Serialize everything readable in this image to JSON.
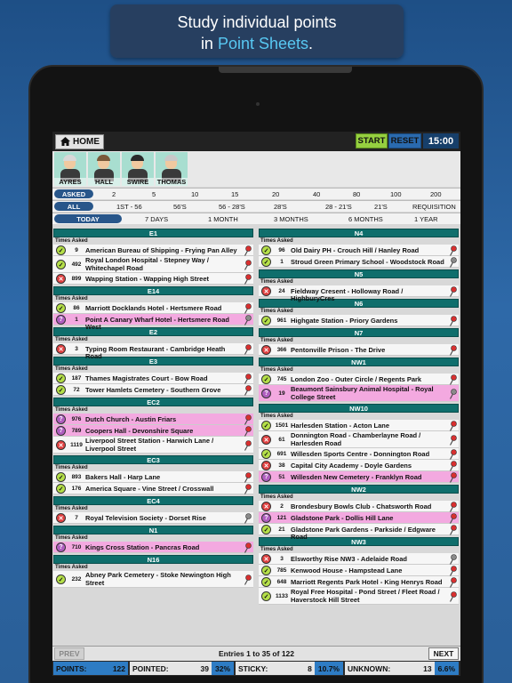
{
  "banner": {
    "line1": "Study individual points",
    "line2_prefix": "in ",
    "line2_highlight": "Point Sheets",
    "line2_suffix": "."
  },
  "toolbar": {
    "home_label": "HOME",
    "start_label": "START",
    "reset_label": "RESET",
    "timer": "15:00"
  },
  "avatars": [
    {
      "name": "AYRES",
      "hair": "#d8d8d8"
    },
    {
      "name": "HALL",
      "hair": "#7a5a3a"
    },
    {
      "name": "SWIRE",
      "hair": "#2a2a2a"
    },
    {
      "name": "THOMAS",
      "hair": "#c8c8c8"
    }
  ],
  "filters": {
    "asked": {
      "selected": "ASKED",
      "options": [
        "2",
        "5",
        "10",
        "15",
        "20",
        "40",
        "80",
        "100",
        "200"
      ]
    },
    "range": {
      "selected": "ALL",
      "options": [
        "1ST - 56",
        "56'S",
        "56 - 28'S",
        "28'S",
        "28 - 21'S",
        "21'S",
        "REQUISITION"
      ]
    },
    "period": {
      "selected": "TODAY",
      "options": [
        "7 DAYS",
        "1 MONTH",
        "3 MONTHS",
        "6 MONTHS",
        "1 YEAR"
      ]
    }
  },
  "times_asked_label": "Times Asked",
  "left_column": [
    {
      "title": "E1",
      "entries": [
        {
          "count": "9",
          "status": "ok",
          "text": "American Bureau of Shipping - Frying Pan Alley",
          "pin": "red",
          "pink": false
        },
        {
          "count": "492",
          "status": "ok",
          "text": "Royal London Hospital - Stepney Way / Whitechapel Road",
          "pin": "red",
          "pink": false
        },
        {
          "count": "899",
          "status": "bad",
          "text": "Wapping Station - Wapping High Street",
          "pin": "red",
          "pink": false
        }
      ]
    },
    {
      "title": "E14",
      "entries": [
        {
          "count": "86",
          "status": "ok",
          "text": "Marriott Docklands Hotel - Hertsmere Road",
          "pin": "red",
          "pink": false
        },
        {
          "count": "1",
          "status": "q",
          "text": "Point A Canary Wharf Hotel - Hertsmere Road West",
          "pin": "grey",
          "pink": true
        }
      ]
    },
    {
      "title": "E2",
      "entries": [
        {
          "count": "3",
          "status": "bad",
          "text": "Typing Room Restaurant - Cambridge Heath Road",
          "pin": "red",
          "pink": false
        }
      ]
    },
    {
      "title": "E3",
      "entries": [
        {
          "count": "187",
          "status": "ok",
          "text": "Thames Magistrates Court - Bow Road",
          "pin": "red",
          "pink": false
        },
        {
          "count": "72",
          "status": "ok",
          "text": "Tower Hamlets Cemetery - Southern Grove",
          "pin": "red",
          "pink": false
        }
      ]
    },
    {
      "title": "EC2",
      "entries": [
        {
          "count": "976",
          "status": "q",
          "text": "Dutch Church - Austin Friars",
          "pin": "red",
          "pink": true
        },
        {
          "count": "789",
          "status": "q",
          "text": "Coopers Hall - Devonshire Square",
          "pin": "red",
          "pink": true
        },
        {
          "count": "1119",
          "status": "bad",
          "text": "Liverpool Street Station - Harwich Lane / Liverpool Street",
          "pin": "red",
          "pink": false
        }
      ]
    },
    {
      "title": "EC3",
      "entries": [
        {
          "count": "893",
          "status": "ok",
          "text": "Bakers Hall - Harp Lane",
          "pin": "red",
          "pink": false
        },
        {
          "count": "176",
          "status": "ok",
          "text": "America Square - Vine Street / Crosswall",
          "pin": "red",
          "pink": false
        }
      ]
    },
    {
      "title": "EC4",
      "entries": [
        {
          "count": "7",
          "status": "bad",
          "text": "Royal Television Society - Dorset Rise",
          "pin": "grey",
          "pink": false
        }
      ]
    },
    {
      "title": "N1",
      "entries": [
        {
          "count": "710",
          "status": "q",
          "text": "Kings Cross Station - Pancras Road",
          "pin": "red",
          "pink": true
        }
      ]
    },
    {
      "title": "N16",
      "entries": [
        {
          "count": "232",
          "status": "ok",
          "text": "Abney Park Cemetery - Stoke Newington High Street",
          "pin": "red",
          "pink": false
        }
      ]
    }
  ],
  "right_column": [
    {
      "title": "N4",
      "entries": [
        {
          "count": "96",
          "status": "ok",
          "text": "Old Dairy PH - Crouch Hill / Hanley Road",
          "pin": "red",
          "pink": false
        },
        {
          "count": "1",
          "status": "ok",
          "text": "Stroud Green Primary School - Woodstock Road",
          "pin": "grey",
          "pink": false
        }
      ]
    },
    {
      "title": "N5",
      "entries": [
        {
          "count": "24",
          "status": "bad",
          "text": "Fieldway Cresent - Holloway Road / HighburyCres",
          "pin": "red",
          "pink": false
        }
      ]
    },
    {
      "title": "N6",
      "entries": [
        {
          "count": "961",
          "status": "ok",
          "text": "Highgate Station - Priory Gardens",
          "pin": "red",
          "pink": false
        }
      ]
    },
    {
      "title": "N7",
      "entries": [
        {
          "count": "366",
          "status": "bad",
          "text": "Pentonville Prison - The Drive",
          "pin": "red",
          "pink": false
        }
      ]
    },
    {
      "title": "NW1",
      "entries": [
        {
          "count": "745",
          "status": "ok",
          "text": "London Zoo - Outer Circle / Regents Park",
          "pin": "red",
          "pink": false
        },
        {
          "count": "19",
          "status": "q",
          "text": "Beaumont Sainsbury Animal Hospital - Royal College Street",
          "pin": "grey",
          "pink": true
        }
      ]
    },
    {
      "title": "NW10",
      "entries": [
        {
          "count": "1501",
          "status": "ok",
          "text": "Harlesden Station - Acton Lane",
          "pin": "red",
          "pink": false
        },
        {
          "count": "61",
          "status": "bad",
          "text": "Donnington Road - Chamberlayne Road / Harlesden Road",
          "pin": "red",
          "pink": false
        },
        {
          "count": "691",
          "status": "ok",
          "text": "Willesden Sports Centre - Donnington Road",
          "pin": "red",
          "pink": false
        },
        {
          "count": "38",
          "status": "bad",
          "text": "Capital City Academy - Doyle Gardens",
          "pin": "red",
          "pink": false
        },
        {
          "count": "51",
          "status": "q",
          "text": "Willesden New Cemetery - Franklyn Road",
          "pin": "red",
          "pink": true
        }
      ]
    },
    {
      "title": "NW2",
      "entries": [
        {
          "count": "2",
          "status": "bad",
          "text": "Brondesbury Bowls Club - Chatsworth Road",
          "pin": "red",
          "pink": false
        },
        {
          "count": "121",
          "status": "q",
          "text": "Gladstone Park - Dollis Hill Lane",
          "pin": "red",
          "pink": true
        },
        {
          "count": "21",
          "status": "ok",
          "text": "Gladstone Park Gardens - Parkside / Edgware Road",
          "pin": "red",
          "pink": false
        }
      ]
    },
    {
      "title": "NW3",
      "entries": [
        {
          "count": "3",
          "status": "bad",
          "text": "Elsworthy Rise NW3 - Adelaide Road",
          "pin": "grey",
          "pink": false
        },
        {
          "count": "785",
          "status": "ok",
          "text": "Kenwood House - Hampstead Lane",
          "pin": "red",
          "pink": false
        },
        {
          "count": "648",
          "status": "ok",
          "text": "Marriott Regents Park Hotel - King Henrys Road",
          "pin": "red",
          "pink": false
        },
        {
          "count": "1133",
          "status": "ok",
          "text": "Royal Free Hospital - Pond Street / Fleet Road / Haverstock Hill Street",
          "pin": "red",
          "pink": false
        }
      ]
    }
  ],
  "pagination": {
    "prev_label": "PREV",
    "next_label": "NEXT",
    "summary": "Entries 1 to 35 of 122"
  },
  "stats": {
    "points_label": "POINTS:",
    "points_value": "122",
    "pointed_label": "POINTED:",
    "pointed_value": "39",
    "pointed_pct": "32%",
    "sticky_label": "STICKY:",
    "sticky_value": "8",
    "sticky_pct": "10.7%",
    "unknown_label": "UNKNOWN:",
    "unknown_value": "13",
    "unknown_pct": "6.6%"
  },
  "colors": {
    "section_header": "#0f6e6c",
    "selected_filter": "#28568a",
    "pink_row": "#f3a9e0",
    "ok_status": "#b5e049",
    "bad_status": "#e04040",
    "question_status": "#b05ec0"
  }
}
